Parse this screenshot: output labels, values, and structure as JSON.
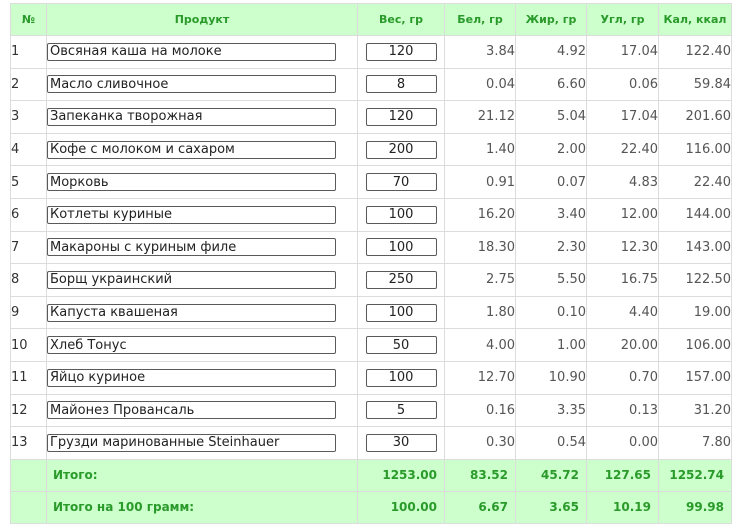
{
  "headers": {
    "num": "№",
    "product": "Продукт",
    "weight": "Вес, гр",
    "protein": "Бел, гр",
    "fat": "Жир, гр",
    "carbs": "Угл, гр",
    "cal": "Кал, ккал"
  },
  "rows": [
    {
      "num": "1",
      "product": "Овсяная каша на молоке",
      "weight": "120",
      "protein": "3.84",
      "fat": "4.92",
      "carbs": "17.04",
      "cal": "122.40"
    },
    {
      "num": "2",
      "product": "Масло сливочное",
      "weight": "8",
      "protein": "0.04",
      "fat": "6.60",
      "carbs": "0.06",
      "cal": "59.84"
    },
    {
      "num": "3",
      "product": "Запеканка творожная",
      "weight": "120",
      "protein": "21.12",
      "fat": "5.04",
      "carbs": "17.04",
      "cal": "201.60"
    },
    {
      "num": "4",
      "product": "Кофе с молоком и сахаром",
      "weight": "200",
      "protein": "1.40",
      "fat": "2.00",
      "carbs": "22.40",
      "cal": "116.00"
    },
    {
      "num": "5",
      "product": "Морковь",
      "weight": "70",
      "protein": "0.91",
      "fat": "0.07",
      "carbs": "4.83",
      "cal": "22.40"
    },
    {
      "num": "6",
      "product": "Котлеты куриные",
      "weight": "100",
      "protein": "16.20",
      "fat": "3.40",
      "carbs": "12.00",
      "cal": "144.00"
    },
    {
      "num": "7",
      "product": "Макароны с куриным филе",
      "weight": "100",
      "protein": "18.30",
      "fat": "2.30",
      "carbs": "12.30",
      "cal": "143.00"
    },
    {
      "num": "8",
      "product": "Борщ украинский",
      "weight": "250",
      "protein": "2.75",
      "fat": "5.50",
      "carbs": "16.75",
      "cal": "122.50"
    },
    {
      "num": "9",
      "product": "Капуста квашеная",
      "weight": "100",
      "protein": "1.80",
      "fat": "0.10",
      "carbs": "4.40",
      "cal": "19.00"
    },
    {
      "num": "10",
      "product": "Хлеб Тонус",
      "weight": "50",
      "protein": "4.00",
      "fat": "1.00",
      "carbs": "20.00",
      "cal": "106.00"
    },
    {
      "num": "11",
      "product": "Яйцо куриное",
      "weight": "100",
      "protein": "12.70",
      "fat": "10.90",
      "carbs": "0.70",
      "cal": "157.00"
    },
    {
      "num": "12",
      "product": "Майонез Провансаль",
      "weight": "5",
      "protein": "0.16",
      "fat": "3.35",
      "carbs": "0.13",
      "cal": "31.20"
    },
    {
      "num": "13",
      "product": "Грузди маринованные Steinhauer",
      "weight": "30",
      "protein": "0.30",
      "fat": "0.54",
      "carbs": "0.00",
      "cal": "7.80"
    }
  ],
  "totals": {
    "label": "Итого:",
    "weight": "1253.00",
    "protein": "83.52",
    "fat": "45.72",
    "carbs": "127.65",
    "cal": "1252.74"
  },
  "per100": {
    "label": "Итого на 100 грамм:",
    "weight": "100.00",
    "protein": "6.67",
    "fat": "3.65",
    "carbs": "10.19",
    "cal": "99.98"
  },
  "colors": {
    "header_bg": "#ccffcc",
    "header_text": "#2a9a2a",
    "border": "#dcdcdc"
  }
}
